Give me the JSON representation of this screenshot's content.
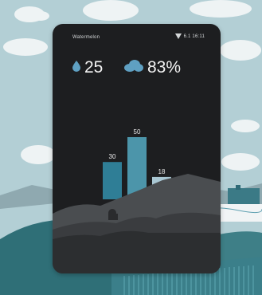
{
  "status": {
    "left_text": "Watermelon",
    "right_text": "6.1 16:11"
  },
  "metrics": {
    "humidity_value": "25",
    "humidity_icon": "water-drop-icon",
    "cloud_value": "83%",
    "cloud_icon": "cloud-icon"
  },
  "colors": {
    "bar_dark": "#2f7e96",
    "bar_mid": "#4c95aa",
    "bar_light": "#a9c7d3",
    "screen_bg": "#1d1e20"
  },
  "chart_data": {
    "type": "bar",
    "categories": [
      "",
      "",
      ""
    ],
    "values": [
      30,
      50,
      18
    ],
    "labels": [
      "30",
      "50",
      "18"
    ]
  }
}
